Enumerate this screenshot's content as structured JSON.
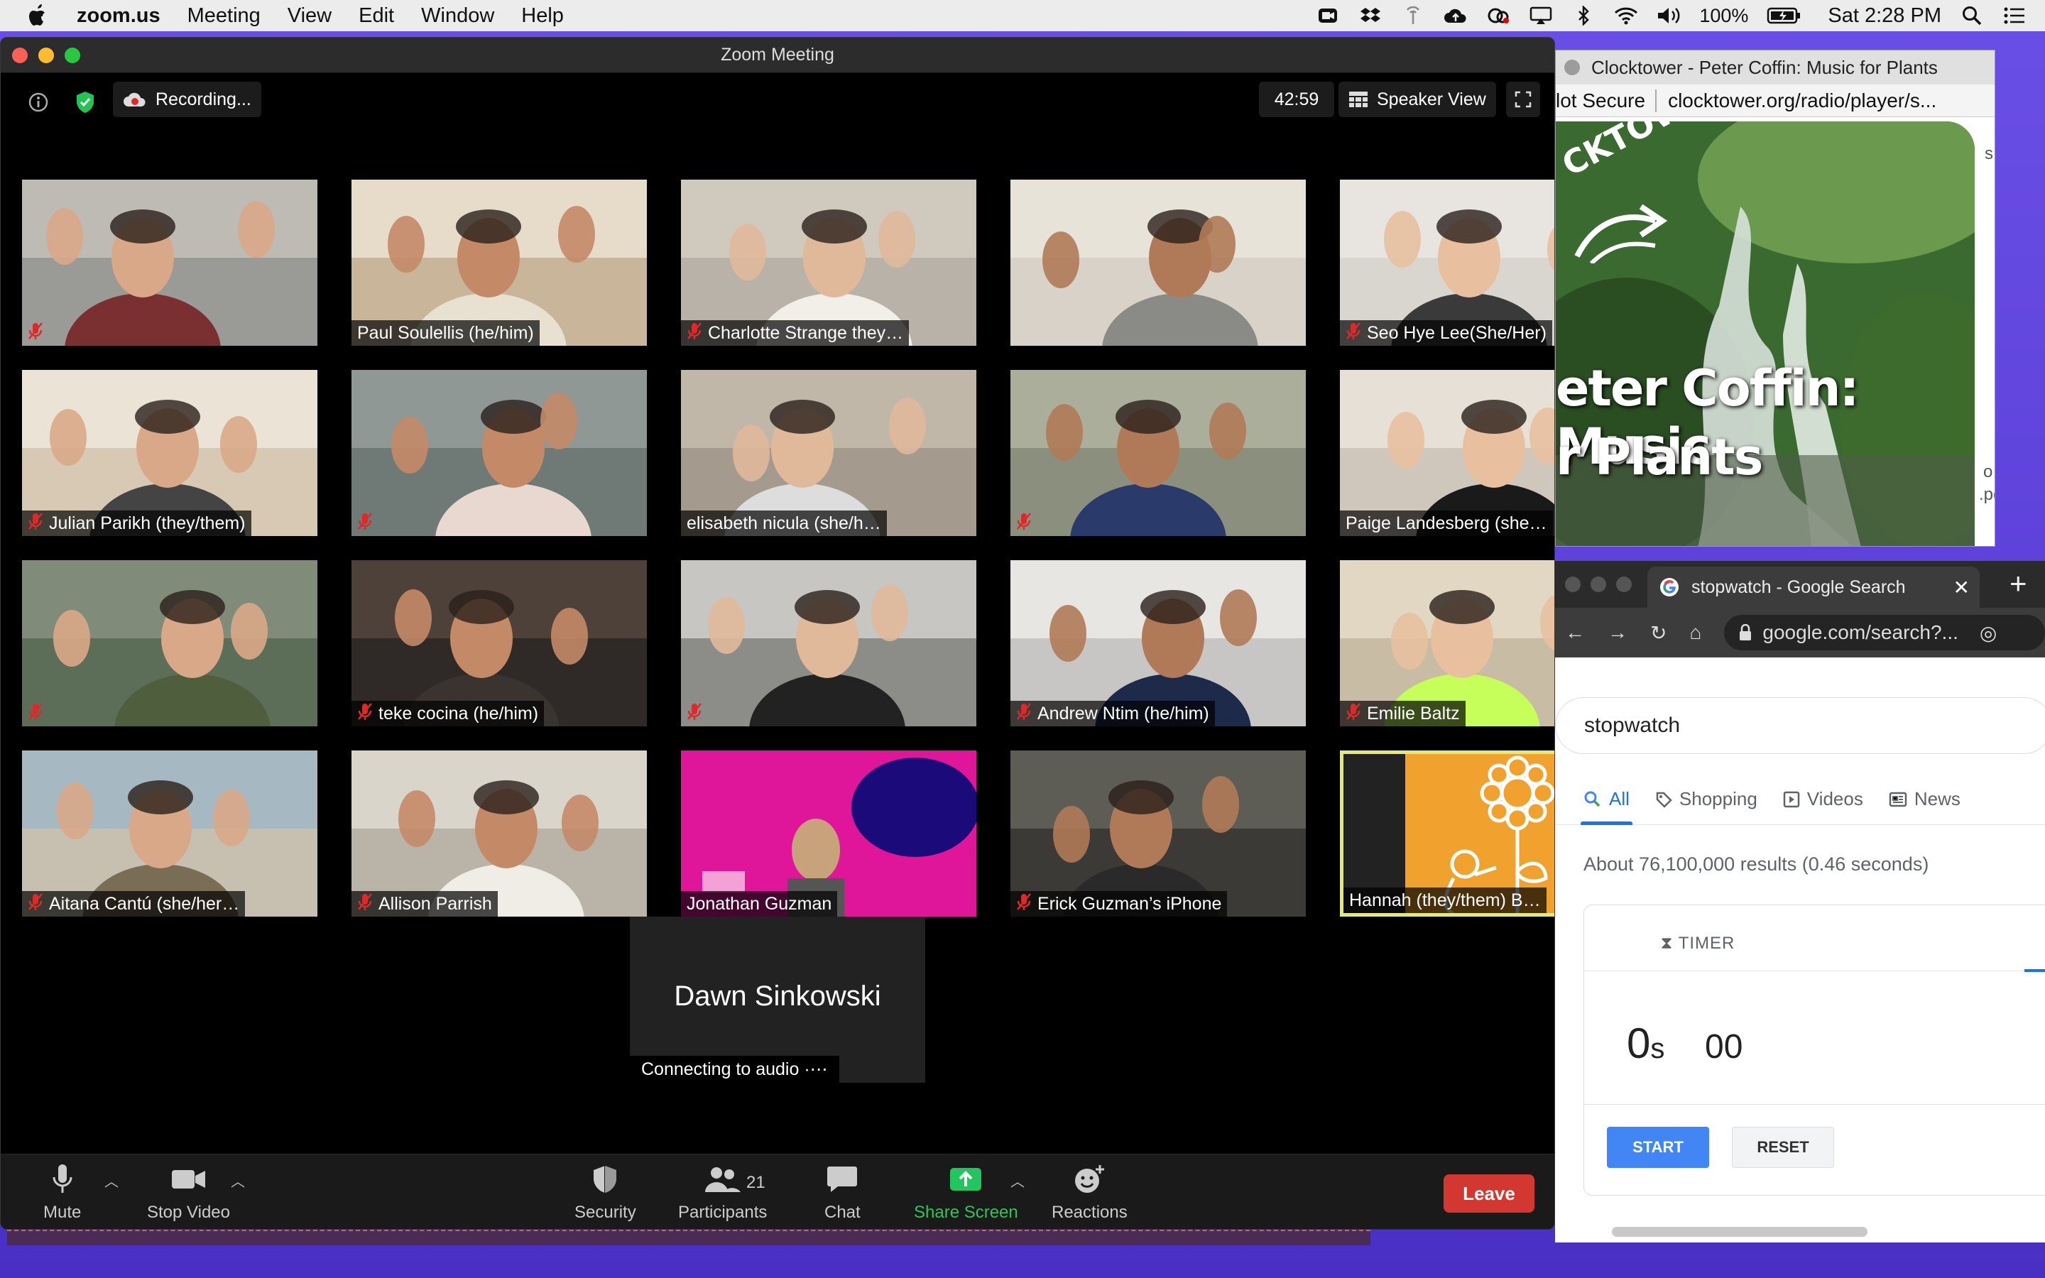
{
  "menubar": {
    "app": "zoom.us",
    "items": [
      "Meeting",
      "View",
      "Edit",
      "Window",
      "Help"
    ],
    "battery": "100%",
    "clock": "Sat 2:28 PM"
  },
  "zoom": {
    "title": "Zoom Meeting",
    "recording": "Recording...",
    "timer": "42:59",
    "view": "Speaker View",
    "tiles": [
      {
        "name": "",
        "muted": true
      },
      {
        "name": "Paul Soulellis (he/him)",
        "muted": false
      },
      {
        "name": "Charlotte Strange they…",
        "muted": true
      },
      {
        "name": "",
        "muted": false
      },
      {
        "name": "Seo Hye Lee(She/Her)",
        "muted": true
      },
      {
        "name": "Julian Parikh (they/them)",
        "muted": true
      },
      {
        "name": "",
        "muted": true
      },
      {
        "name": "elisabeth nicula (she/h…",
        "muted": false
      },
      {
        "name": "",
        "muted": true
      },
      {
        "name": "Paige Landesberg (she…",
        "muted": false
      },
      {
        "name": "",
        "muted": true
      },
      {
        "name": "teke cocina (he/him)",
        "muted": true
      },
      {
        "name": "",
        "muted": true
      },
      {
        "name": "Andrew Ntim (he/him)",
        "muted": true
      },
      {
        "name": "Emilie Baltz",
        "muted": true
      },
      {
        "name": "Aitana Cantú (she/her…",
        "muted": true
      },
      {
        "name": "Allison Parrish",
        "muted": true
      },
      {
        "name": "Jonathan Guzman",
        "muted": false
      },
      {
        "name": "Erick Guzman’s iPhone",
        "muted": true
      },
      {
        "name": "Hannah (they/them) B…",
        "muted": false
      }
    ],
    "dawn": {
      "name": "Dawn Sinkowski",
      "status": "Connecting to audio ·⋯"
    },
    "toolbar": {
      "mute": "Mute",
      "video": "Stop Video",
      "security": "Security",
      "participants": "Participants",
      "participants_count": "21",
      "chat": "Chat",
      "share": "Share Screen",
      "reactions": "Reactions",
      "leave": "Leave"
    }
  },
  "clocktower": {
    "title": "Clocktower - Peter Coffin: Music for Plants",
    "secure": "lot Secure",
    "url": "clocktower.org/radio/player/s...",
    "logo": "CKTOWER",
    "heading1": "eter Coffin: Music",
    "heading2": "r Plants",
    "side1": "s",
    "side2": "o",
    "side3": ".pdf"
  },
  "chrome": {
    "tab": "stopwatch - Google Search",
    "url": "google.com/search?...",
    "query": "stopwatch",
    "tabs": [
      "All",
      "Shopping",
      "Videos",
      "News"
    ],
    "stats": "About 76,100,000 results (0.46 seconds)",
    "timer_label": "TIMER",
    "time_s": "0",
    "time_unit": "s",
    "time_cs": "00",
    "start": "START",
    "reset": "RESET"
  },
  "colors": {
    "leave": "#d2382f",
    "share": "#22c55e",
    "google_blue": "#1a73e8",
    "desktop": "#5b3fd8"
  }
}
